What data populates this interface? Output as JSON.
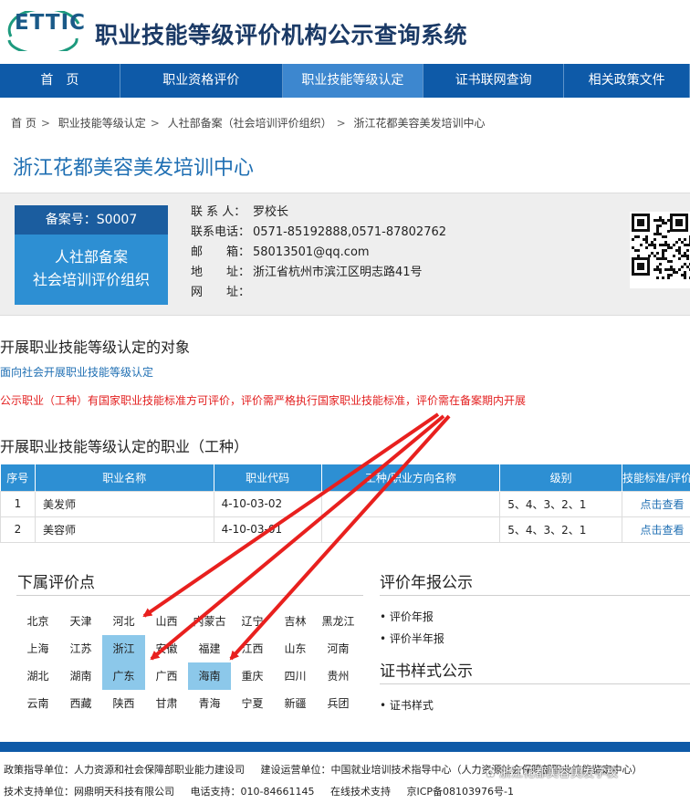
{
  "header": {
    "logo_text": "ETTIC",
    "site_title": "职业技能等级评价机构公示查询系统"
  },
  "nav": [
    {
      "label": "首　页",
      "width": 134
    },
    {
      "label": "职业资格评价",
      "width": 181
    },
    {
      "label": "职业技能等级认定",
      "width": 157,
      "active": true
    },
    {
      "label": "证书联网查询",
      "width": 157
    },
    {
      "label": "相关政策文件",
      "width": 140
    }
  ],
  "breadcrumb": [
    "首 页",
    "职业技能等级认定",
    "人社部备案（社会培训评价组织）",
    "浙江花都美容美发培训中心"
  ],
  "org": {
    "name": "浙江花都美容美发培训中心",
    "record_no": "备案号：S0007",
    "type_line1": "人社部备案",
    "type_line2": "社会培训评价组织",
    "contacts": [
      {
        "label": "联 系 人：",
        "value": "罗校长"
      },
      {
        "label": "联系电话：",
        "value": "0571-85192888,0571-87802762"
      },
      {
        "label": "邮　　箱：",
        "value": "58013501@qq.com"
      },
      {
        "label": "地　　址：",
        "value": "浙江省杭州市滨江区明志路41号"
      },
      {
        "label": "网　　址：",
        "value": ""
      }
    ]
  },
  "scope": {
    "title": "开展职业技能等级认定的对象",
    "note": "面向社会开展职业技能等级认定",
    "warning": "公示职业（工种）有国家职业技能标准方可评价，评价需严格执行国家职业技能标准，评价需在备案期内开展"
  },
  "occupations": {
    "title": "开展职业技能等级认定的职业（工种）",
    "headers": [
      "序号",
      "职业名称",
      "职业代码",
      "工种/职业方向名称",
      "级别",
      "技能标准/评价"
    ],
    "rows": [
      {
        "no": "1",
        "name": "美发师",
        "code": "4-10-03-02",
        "direction": "",
        "level": "5、4、3、2、1",
        "link": "点击查看"
      },
      {
        "no": "2",
        "name": "美容师",
        "code": "4-10-03-01",
        "direction": "",
        "level": "5、4、3、2、1",
        "link": "点击查看"
      }
    ]
  },
  "sites": {
    "title": "下属评价点",
    "provinces": [
      "北京",
      "天津",
      "河北",
      "山西",
      "内蒙古",
      "辽宁",
      "吉林",
      "黑龙江",
      "上海",
      "江苏",
      "浙江",
      "安徽",
      "福建",
      "江西",
      "山东",
      "河南",
      "湖北",
      "湖南",
      "广东",
      "广西",
      "海南",
      "重庆",
      "四川",
      "贵州",
      "云南",
      "西藏",
      "陕西",
      "甘肃",
      "青海",
      "宁夏",
      "新疆",
      "兵团"
    ],
    "highlighted": [
      "浙江",
      "广东",
      "海南"
    ]
  },
  "annual": {
    "title": "评价年报公示",
    "items": [
      "• 评价年报",
      "• 评价半年报"
    ]
  },
  "cert": {
    "title": "证书样式公示",
    "items": [
      "• 证书样式"
    ]
  },
  "footer": {
    "line1": [
      "政策指导单位：人力资源和社会保障部职业能力建设司",
      "建设运营单位：中国就业培训技术指导中心（人力资源社会保障部职业技能鉴定中心）"
    ],
    "line2": [
      "技术支持单位：网鼎明天科技有限公司",
      "电话支持：010-84661145",
      "在线技术支持",
      "京ICP备08103976号-1"
    ],
    "watermark": "浙江花都美容美发学校"
  },
  "colors": {
    "nav_blue": "#0e5aa8",
    "accent_blue": "#2d8fd3",
    "warning_red": "#e32020",
    "arrow_red": "#e8201e"
  }
}
